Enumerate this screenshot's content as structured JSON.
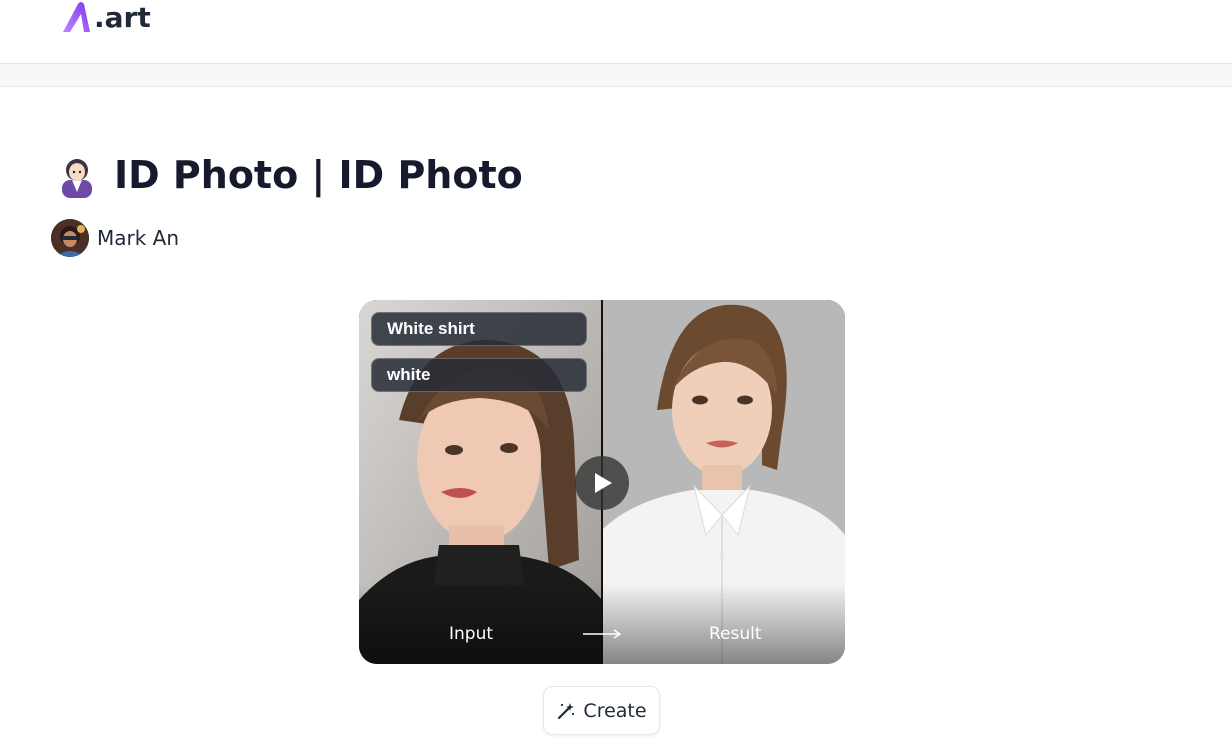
{
  "header": {
    "logo_text": ".art",
    "logo_icon": "brand-logo-icon"
  },
  "page": {
    "title_icon": "office-worker-emoji-icon",
    "title": "ID Photo | ID Photo",
    "author": {
      "name": "Mark An",
      "avatar_icon": "avatar"
    }
  },
  "preview": {
    "tags": [
      "White shirt",
      "white"
    ],
    "input_label": "Input",
    "result_label": "Result",
    "play_icon": "play-icon",
    "arrow_icon": "arrow-right-icon"
  },
  "actions": {
    "create_label": "Create",
    "create_icon": "magic-wand-icon"
  },
  "colors": {
    "brand_purple": "#8b5cf6",
    "title": "#151a2d"
  }
}
